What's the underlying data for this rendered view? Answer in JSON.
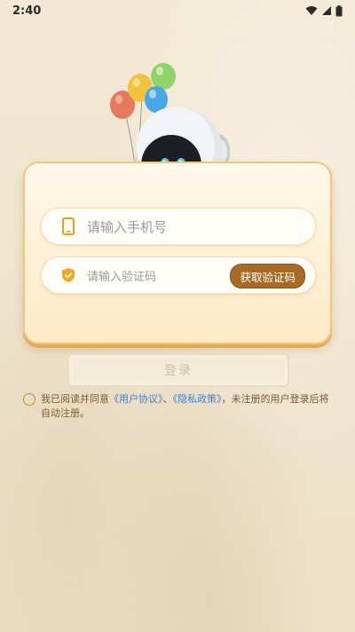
{
  "status_bar": {
    "time": "2:40"
  },
  "login_form": {
    "phone_placeholder": "请输入手机号",
    "code_placeholder": "请输入验证码",
    "get_code_button": "获取验证码"
  },
  "login_button": "登录",
  "agreement": {
    "prefix": "我已阅读并同意",
    "user_agreement": "《用户协议》",
    "separator": "、",
    "privacy_policy": "《隐私政策》",
    "suffix": "，未注册的用户登录后将自动注册。"
  },
  "colors": {
    "accent_brown": "#a86a24",
    "link_blue": "#3b7fd9",
    "card_border": "#f0c581"
  },
  "icons": [
    "wifi-icon",
    "cell-signal-icon",
    "battery-icon",
    "phone-icon",
    "shield-icon",
    "robot-mascot"
  ]
}
